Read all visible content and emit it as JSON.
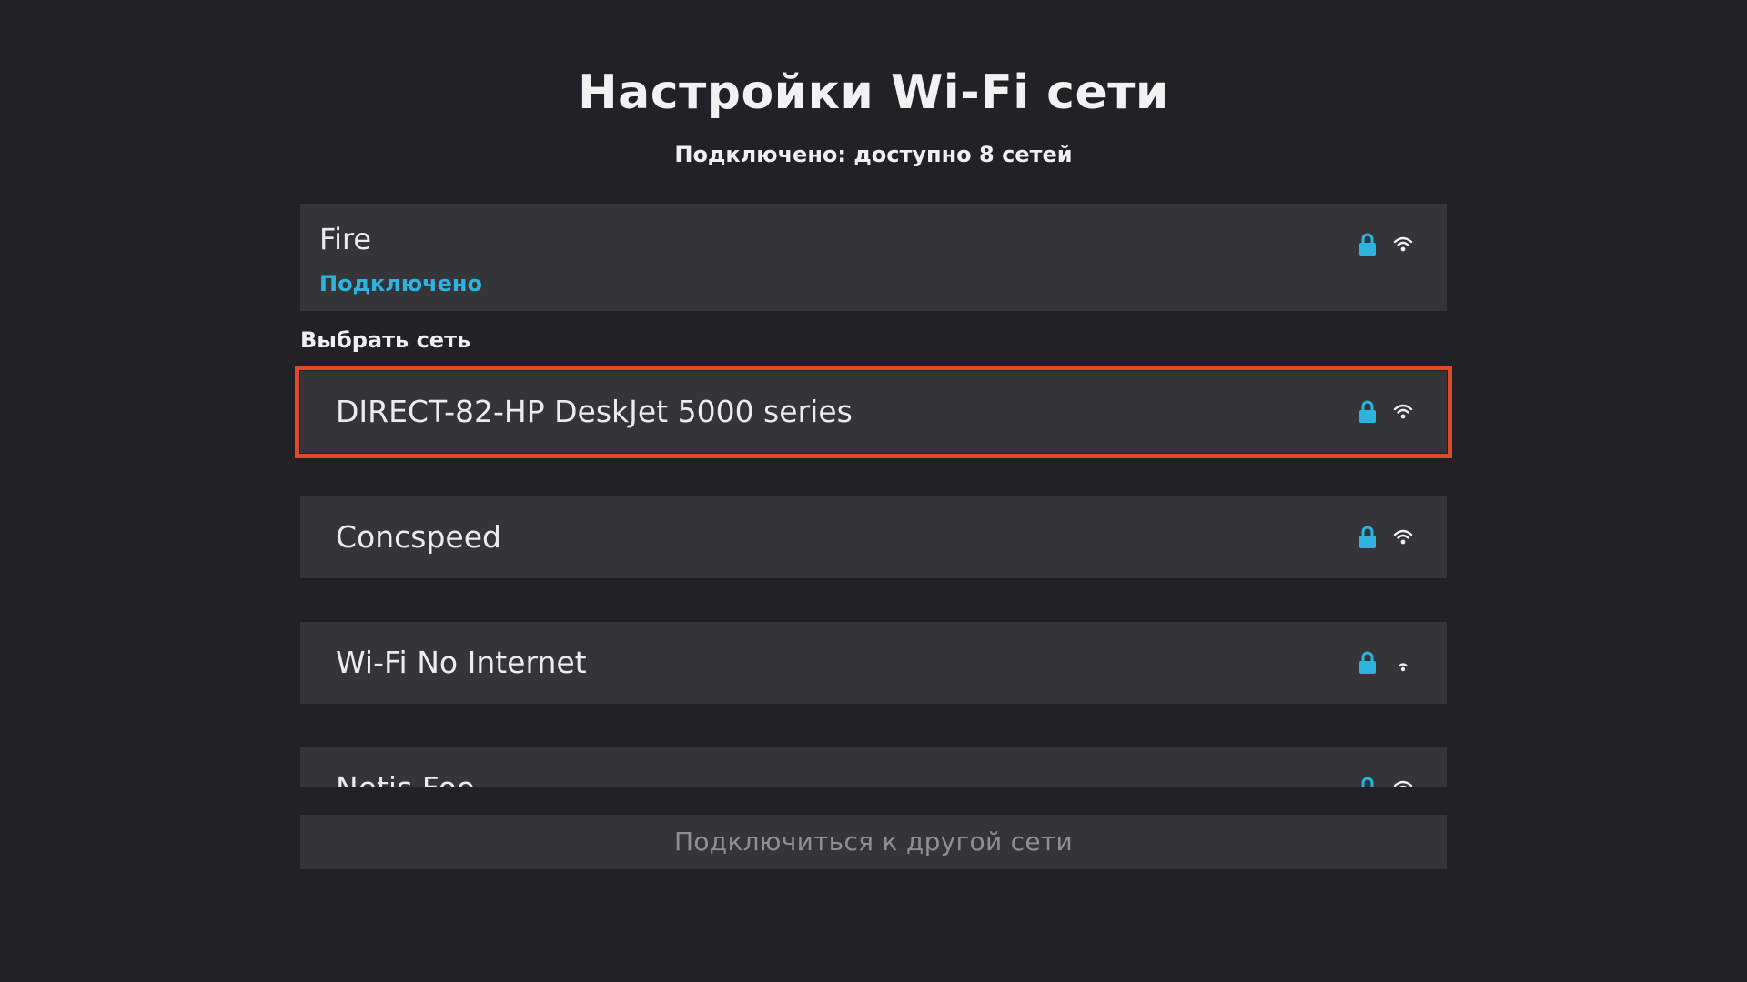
{
  "page": {
    "title": "Настройки Wi-Fi сети",
    "subtitle": "Подключено: доступно 8 сетей"
  },
  "connected": {
    "name": "Fire",
    "status": "Подключено",
    "secured": true,
    "signal_bars": 3
  },
  "section_label": "Выбрать сеть",
  "networks": [
    {
      "name": "DIRECT-82-HP DeskJet 5000 series",
      "secured": true,
      "signal_bars": 3,
      "focused": true
    },
    {
      "name": "Concspeed",
      "secured": true,
      "signal_bars": 3,
      "focused": false
    },
    {
      "name": "Wi-Fi No Internet",
      "secured": true,
      "signal_bars": 1,
      "focused": false
    },
    {
      "name": "Netis Foo",
      "secured": true,
      "signal_bars": 3,
      "focused": false
    }
  ],
  "other_network_button": "Подключиться к другой сети",
  "icons": {
    "lock": "lock-icon",
    "wifi": "wifi-signal-icon"
  },
  "colors": {
    "background": "#222226",
    "card": "#353539",
    "accent": "#2cb4de",
    "focus": "#e04a26",
    "muted_text": "#8f8f93"
  }
}
